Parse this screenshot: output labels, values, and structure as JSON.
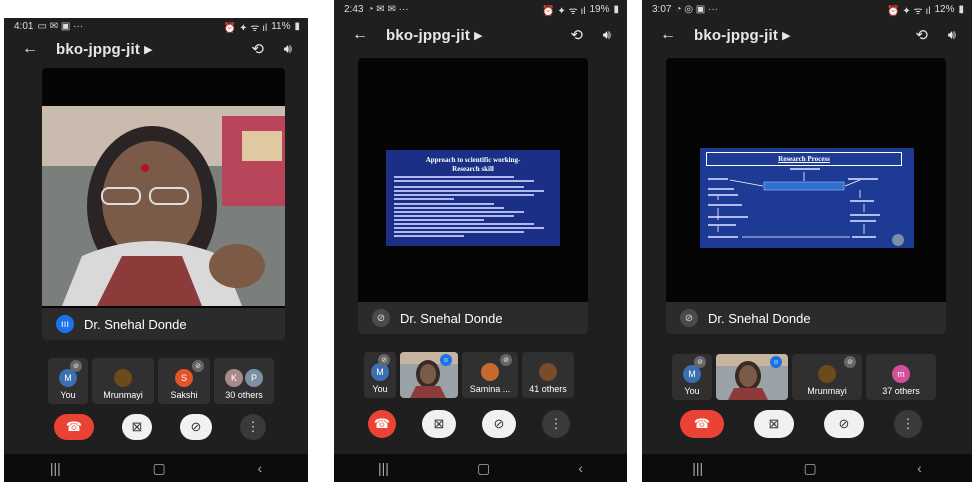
{
  "panels": [
    {
      "status": {
        "time": "4:01",
        "battery": "11%"
      },
      "header": {
        "title": "bko-jppg-jit",
        "title_suffix": "▸"
      },
      "speaker": "Dr. Snehal Donde",
      "tiles": [
        {
          "label": "You",
          "avatar": "M",
          "color": "#3d6fb5"
        },
        {
          "label": "Mrunmayi",
          "avatar": "",
          "color": "#6b4a1e"
        },
        {
          "label": "Sakshi",
          "avatar": "S",
          "color": "#e2552b"
        },
        {
          "label": "30 others",
          "avatar": "K",
          "avatar2": "P",
          "color": "#a98c88",
          "color2": "#7d8fa5"
        }
      ]
    },
    {
      "status": {
        "time": "2:43",
        "battery": "19%"
      },
      "header": {
        "title": "bko-jppg-jit",
        "title_suffix": "▸"
      },
      "speaker": "Dr. Snehal Donde",
      "slide": {
        "title": "Approach to scientific working-\nResearch skill"
      },
      "tiles": [
        {
          "label": "You",
          "avatar": "M",
          "color": "#3d6fb5"
        },
        {
          "label": "",
          "avatar": "",
          "color": "#6b5a4a"
        },
        {
          "label": "Samina ...",
          "avatar": "",
          "color": "#c46a2f"
        },
        {
          "label": "41 others",
          "avatar": "",
          "color": "#7a4a2a"
        }
      ]
    },
    {
      "status": {
        "time": "3:07",
        "battery": "12%"
      },
      "header": {
        "title": "bko-jppg-jit",
        "title_suffix": "▸"
      },
      "speaker": "Dr. Snehal Donde",
      "slide": {
        "title": "Research Process"
      },
      "tiles": [
        {
          "label": "You",
          "avatar": "M",
          "color": "#3d6fb5"
        },
        {
          "label": "",
          "avatar": "",
          "color": "#6b5a4a"
        },
        {
          "label": "Mrunmayi",
          "avatar": "",
          "color": "#6b4a1e"
        },
        {
          "label": "37 others",
          "avatar": "m",
          "color": "#d24f9c"
        }
      ]
    }
  ],
  "colors": {
    "end_call": "#ea4335",
    "background": "#1f1f1f",
    "accent": "#1a73e8"
  },
  "icons": [
    "back-arrow-icon",
    "switch-camera-icon",
    "speaker-icon",
    "mic-off-icon",
    "camera-off-icon",
    "end-call-icon",
    "more-icon"
  ]
}
